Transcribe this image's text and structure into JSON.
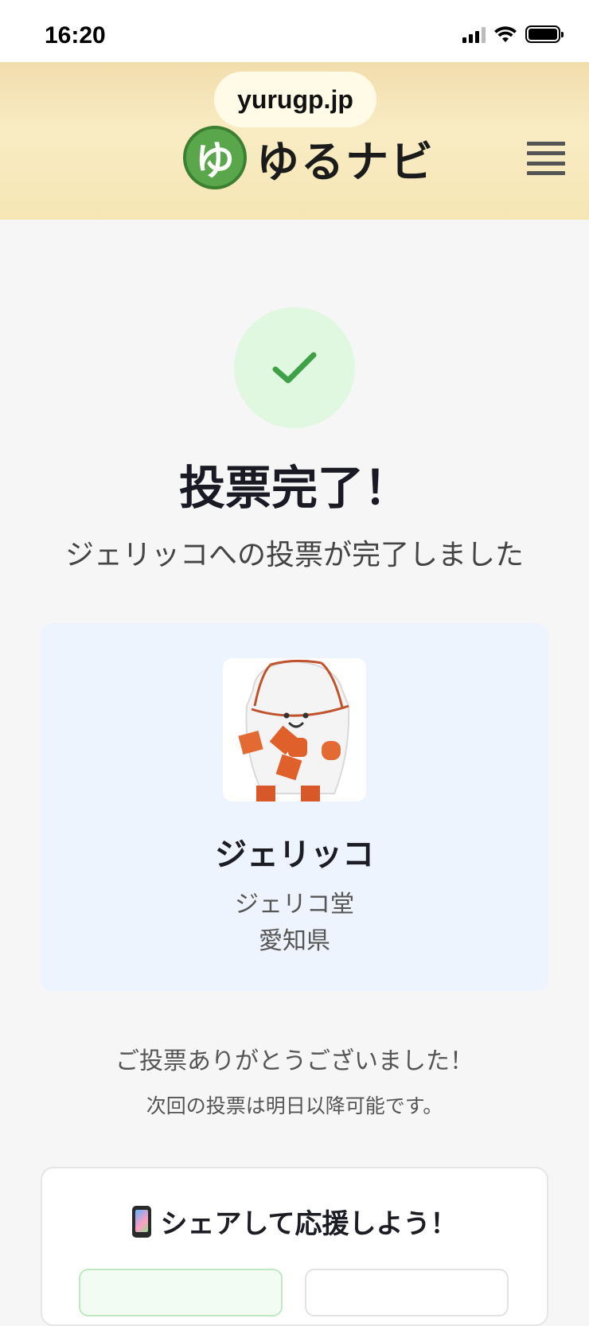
{
  "status": {
    "time": "16:20"
  },
  "browser": {
    "url": "yurugp.jp"
  },
  "header": {
    "logo_mark": "ゆ",
    "logo_text": "ゆるナビ"
  },
  "main": {
    "title": "投票完了！",
    "subtitle": "ジェリッコへの投票が完了しました",
    "thanks": "ご投票ありがとうございました！",
    "next_vote": "次回の投票は明日以降可能です。"
  },
  "character": {
    "name": "ジェリッコ",
    "organization": "ジェリコ堂",
    "prefecture": "愛知県"
  },
  "share": {
    "title": "シェアして応援しよう！",
    "icon": "mobile-phone-icon"
  },
  "colors": {
    "accent_green": "#4caf50",
    "check_bg": "#dff8df",
    "card_bg": "#eef4fd",
    "header_bg": "#f6e6b4"
  }
}
